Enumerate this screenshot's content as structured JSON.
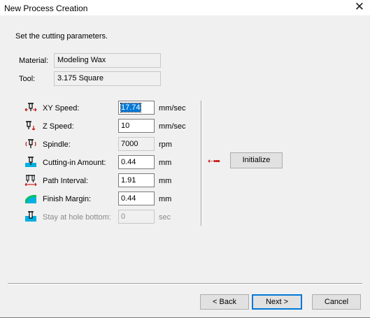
{
  "window": {
    "title": "New Process Creation"
  },
  "intro": "Set the cutting parameters.",
  "info": {
    "material_label": "Material:",
    "material_value": "Modeling Wax",
    "tool_label": "Tool:",
    "tool_value": "3.175 Square"
  },
  "params": {
    "xy_speed": {
      "label": "XY Speed:",
      "value": "17.74",
      "unit": "mm/sec",
      "icon": "xy-speed-icon"
    },
    "z_speed": {
      "label": "Z Speed:",
      "value": "10",
      "unit": "mm/sec",
      "icon": "z-speed-icon"
    },
    "spindle": {
      "label": "Spindle:",
      "value": "7000",
      "unit": "rpm",
      "icon": "spindle-icon"
    },
    "cutting_in": {
      "label": "Cutting-in Amount:",
      "value": "0.44",
      "unit": "mm",
      "icon": "cutting-in-icon"
    },
    "path_interval": {
      "label": "Path Interval:",
      "value": "1.91",
      "unit": "mm",
      "icon": "path-interval-icon"
    },
    "finish_margin": {
      "label": "Finish Margin:",
      "value": "0.44",
      "unit": "mm",
      "icon": "finish-margin-icon"
    },
    "stay_hole": {
      "label": "Stay at hole bottom:",
      "value": "0",
      "unit": "sec",
      "icon": "stay-hole-icon"
    }
  },
  "buttons": {
    "initialize": "Initialize",
    "back": "< Back",
    "next": "Next >",
    "cancel": "Cancel"
  },
  "colors": {
    "selection": "#0078d7",
    "accent": "#0078d7",
    "arrow": "#c00000",
    "icon_cyan": "#00b0e0"
  }
}
